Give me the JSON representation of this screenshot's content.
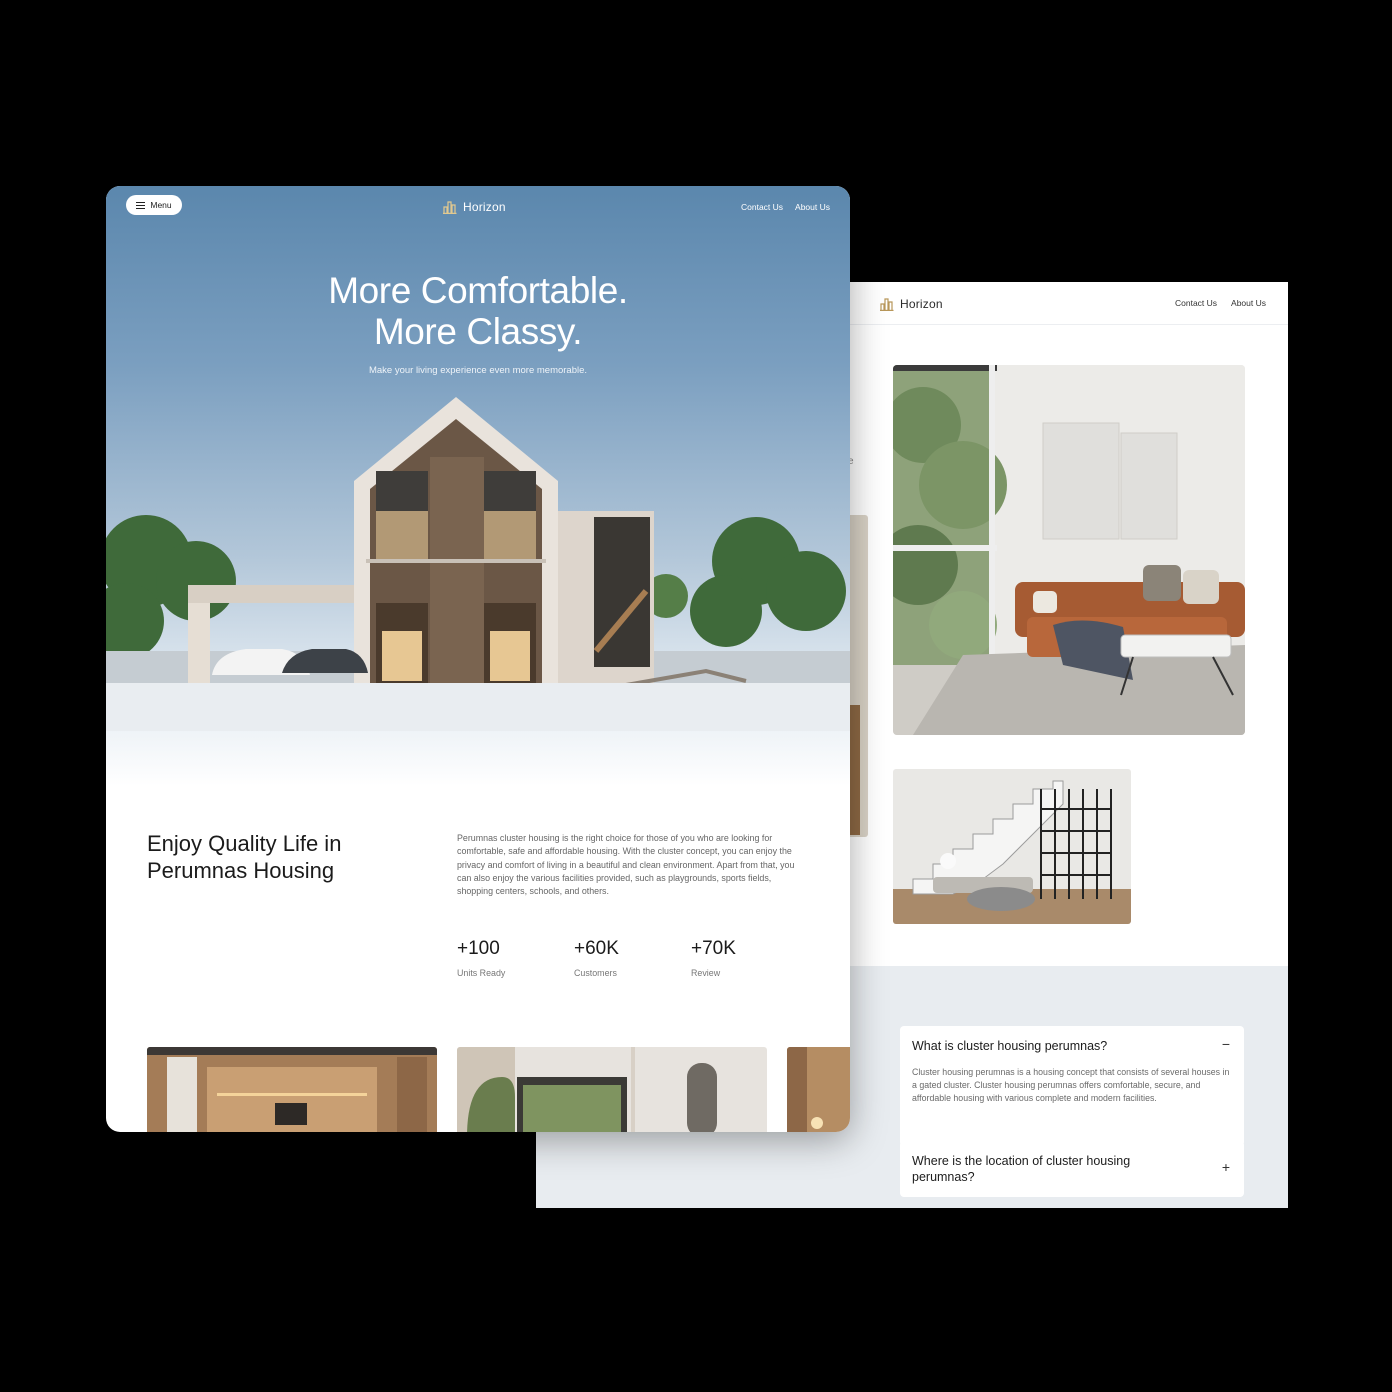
{
  "brand": {
    "logo_text": "Horizon",
    "accent": "#b8975a"
  },
  "home": {
    "menu_label": "Menu",
    "nav_links": [
      "Contact Us",
      "About Us"
    ],
    "hero_line1": "More Comfortable.",
    "hero_line2": "More Classy.",
    "hero_subtitle": "Make your living experience even more memorable.",
    "about_title_line1": "Enjoy Quality Life in",
    "about_title_line2": "Perumnas Housing",
    "about_text": "Perumnas cluster housing is the right choice for those of you who are looking for comfortable, safe and affordable housing. With the cluster concept, you can enjoy the privacy and comfort of living in a beautiful and clean environment. Apart from that, you can also enjoy the various facilities provided, such as playgrounds, sports fields, shopping centers, schools, and others.",
    "stats": [
      {
        "value": "+100",
        "label": "Units Ready"
      },
      {
        "value": "+60K",
        "label": "Customers"
      },
      {
        "value": "+70K",
        "label": "Review"
      }
    ]
  },
  "detail": {
    "nav_links": [
      "Contact Us",
      "About Us"
    ],
    "faq": [
      {
        "question": "What is cluster housing perumnas?",
        "answer": "Cluster housing perumnas is a housing concept that consists of several houses in a gated cluster. Cluster housing perumnas offers comfortable, secure, and affordable housing with various complete and modern facilities.",
        "toggle": "−",
        "expanded": true
      },
      {
        "question": "Where is the location of cluster housing perumnas?",
        "answer": "",
        "toggle": "+",
        "expanded": false
      }
    ]
  }
}
